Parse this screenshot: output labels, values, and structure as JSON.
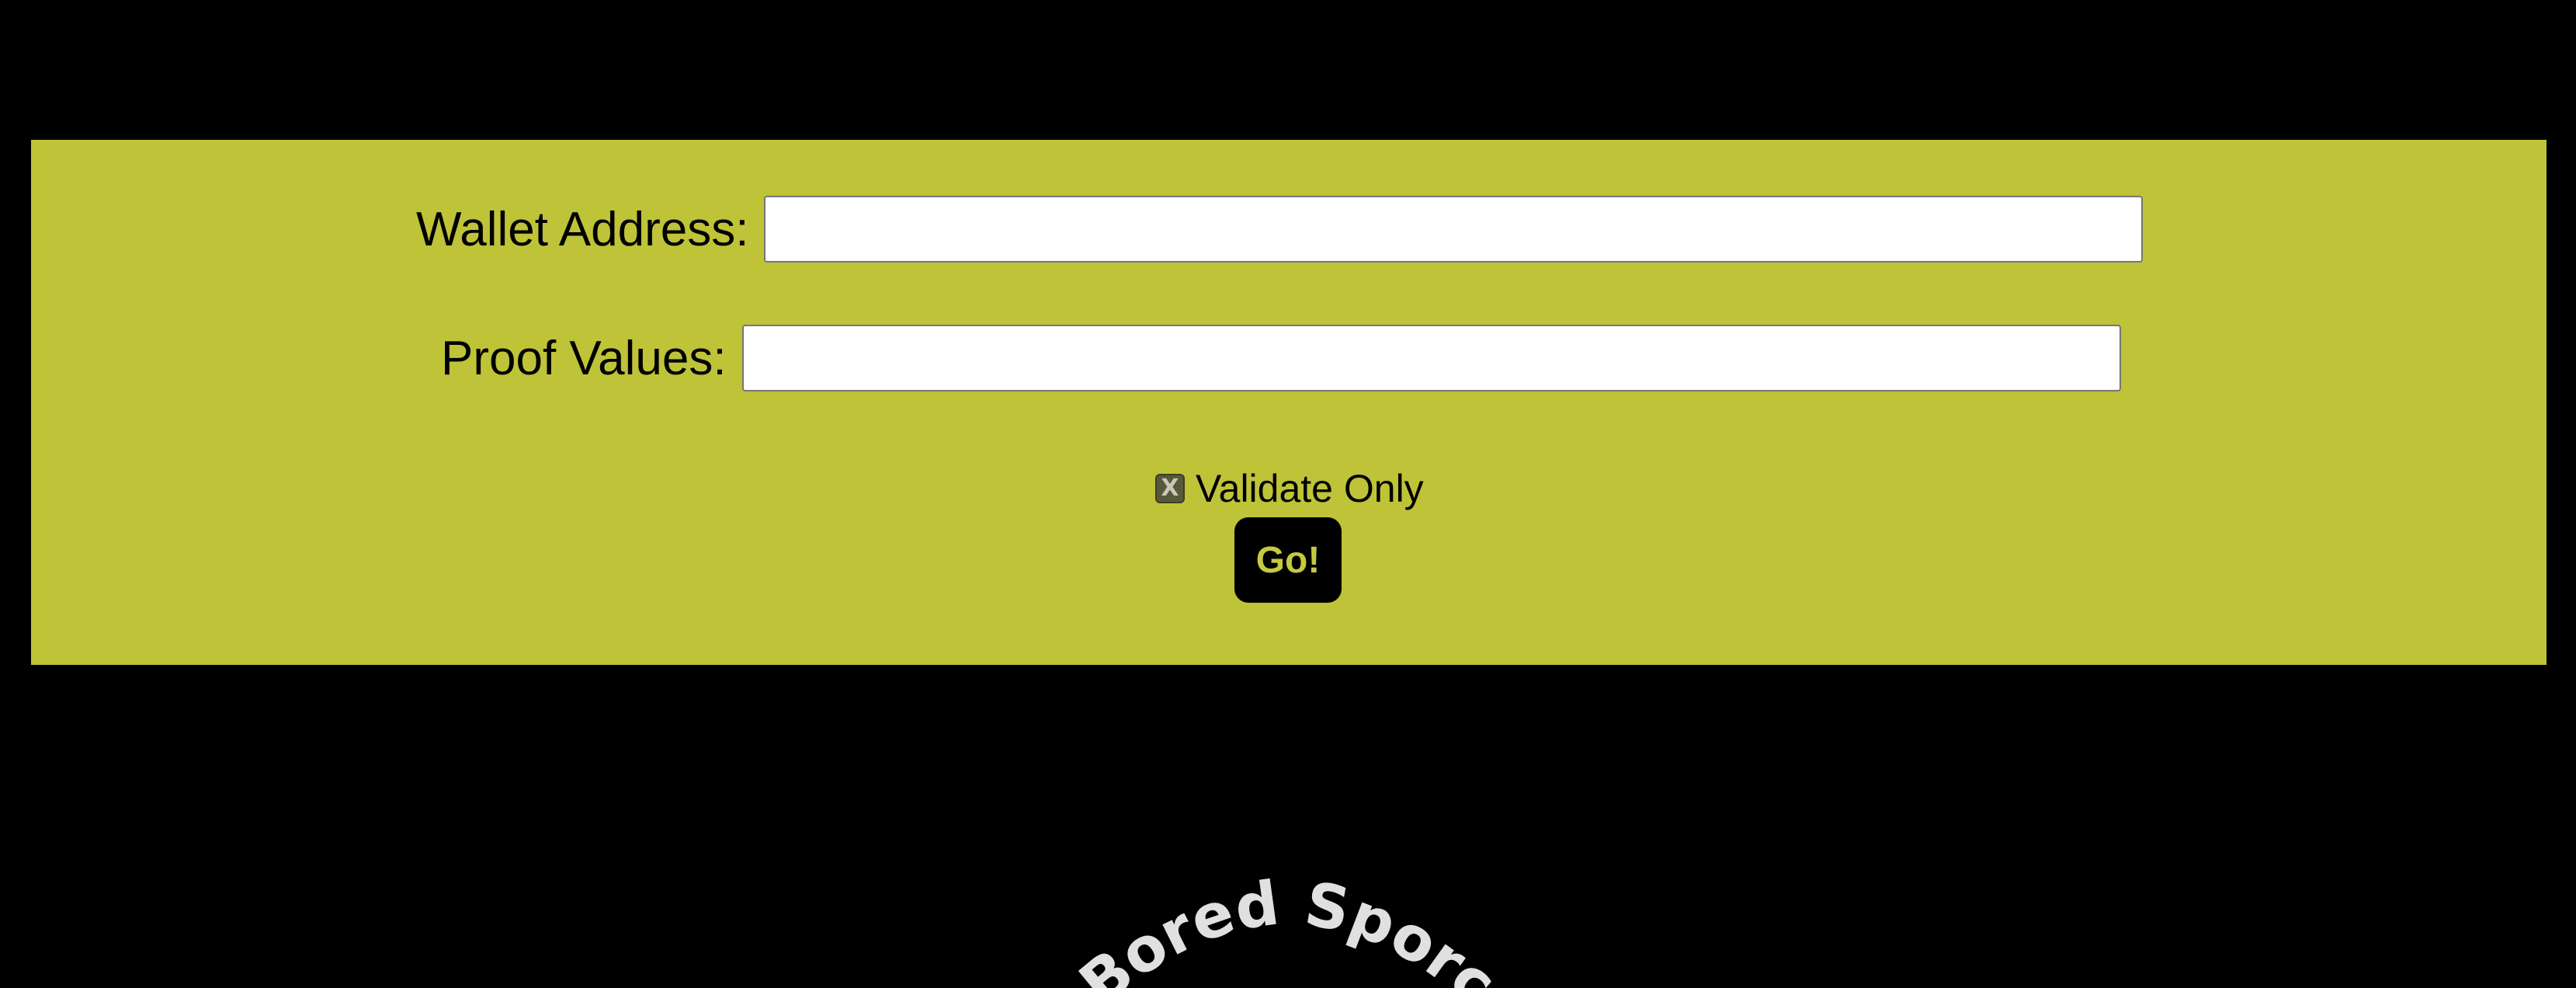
{
  "form": {
    "wallet_label": "Wallet Address:",
    "wallet_value": "",
    "wallet_placeholder": "",
    "proof_label": "Proof Values:",
    "proof_value": "",
    "proof_placeholder": "",
    "validate_checkbox_mark": "X",
    "validate_label": "Validate Only",
    "validate_checked": true,
    "go_label": "Go!"
  },
  "logo": {
    "text": "Bored Sporc"
  },
  "colors": {
    "background": "#000000",
    "panel": "#bfc337",
    "button_text": "#c5c93e",
    "logo_text": "#e0e0e0"
  },
  "icons": {
    "checkbox": "checkbox-checked-x-icon"
  }
}
